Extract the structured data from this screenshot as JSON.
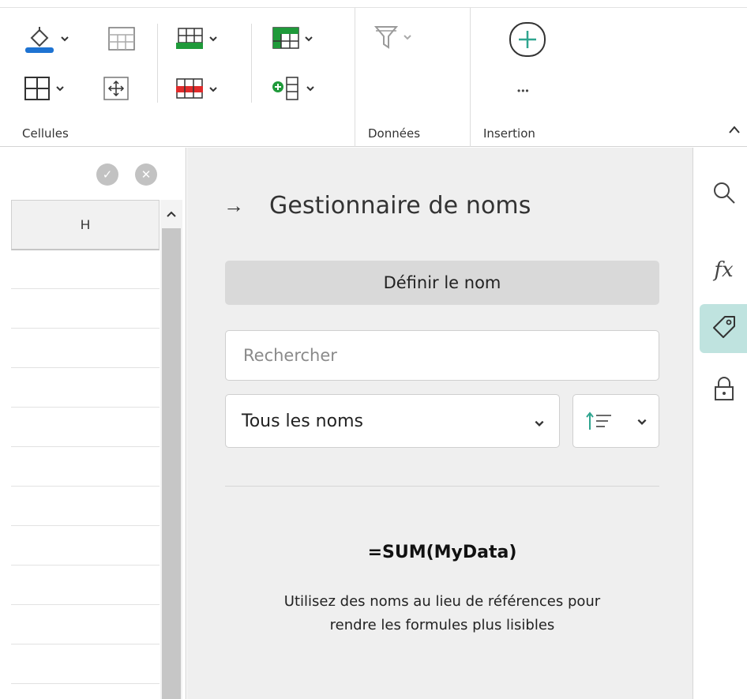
{
  "ribbon": {
    "groups": {
      "cells_label": "Cellules",
      "data_label": "Données",
      "insert_label": "Insertion"
    },
    "insert_more": "•••",
    "collapse_glyph": "^"
  },
  "icons": {
    "fill": "fill-color-icon",
    "borders_none": "cell-grid-icon",
    "borders": "borders-icon",
    "move": "move-cell-icon",
    "insert_rows": "insert-table-icon",
    "delete_rows": "delete-table-icon",
    "table_style": "table-style-icon",
    "insert_cell": "insert-cell-icon",
    "filter": "filter-icon",
    "insert_plus": "plus-circle-icon"
  },
  "sheet": {
    "confirm_glyph": "✓",
    "cancel_glyph": "✕",
    "column_header": "H",
    "scroll_up_glyph": "^"
  },
  "panel": {
    "back_arrow": "→",
    "title": "Gestionnaire de noms",
    "define_button": "Définir le nom",
    "search_placeholder": "Rechercher",
    "filter_value": "Tous les noms",
    "formula_example": "=SUM(MyData)",
    "hint_line1": "Utilisez des noms au lieu de références pour",
    "hint_line2": "rendre les formules plus lisibles"
  },
  "rail": {
    "items": [
      "search-icon",
      "function-icon",
      "tag-icon",
      "lock-icon"
    ],
    "fx_label": "fx",
    "active": "tag-icon"
  },
  "colors": {
    "accent": "#2fa58f",
    "rail_active_bg": "#bfe3df",
    "fill_underline": "#1e73d2",
    "green_table": "#1f9a3a",
    "red_table": "#e02b2b"
  }
}
